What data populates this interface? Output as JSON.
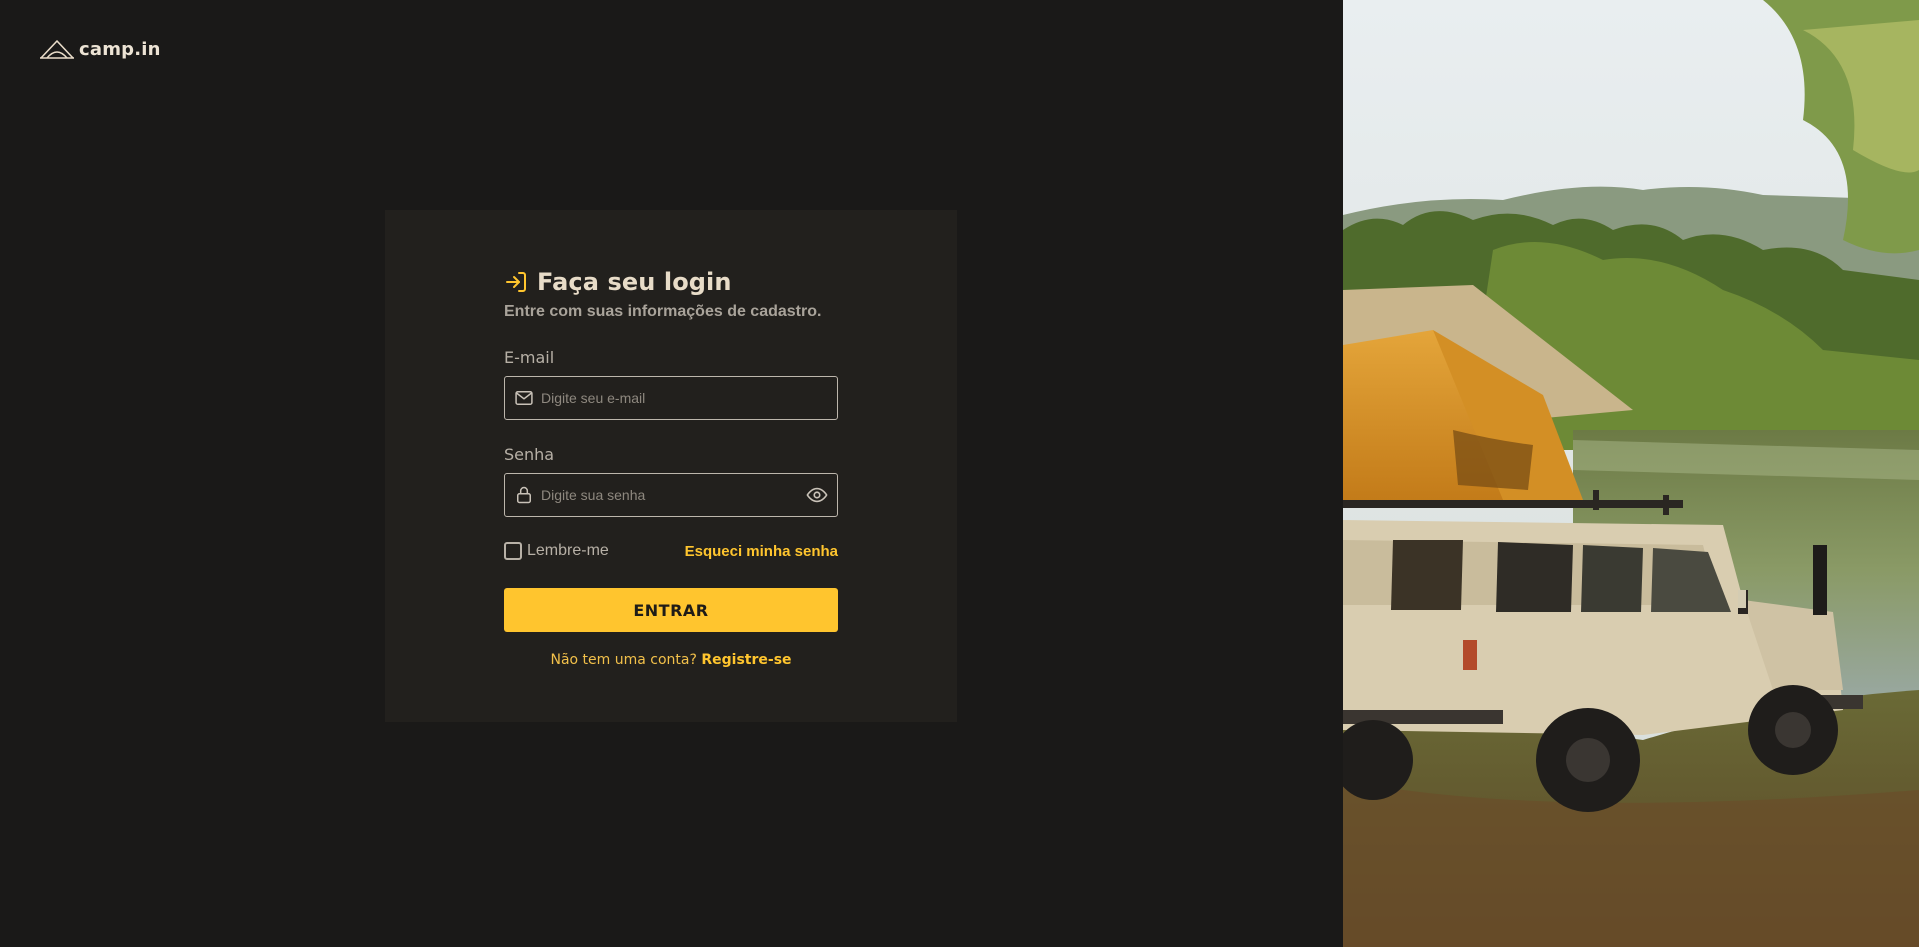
{
  "brand": {
    "name": "camp.in",
    "icon": "tent-logo-icon"
  },
  "login": {
    "title": "Faça seu login",
    "title_icon": "login-arrow-icon",
    "subtitle": "Entre com suas informações de cadastro.",
    "email": {
      "label": "E-mail",
      "placeholder": "Digite seu e-mail",
      "value": "",
      "icon": "mail-icon"
    },
    "password": {
      "label": "Senha",
      "placeholder": "Digite sua senha",
      "value": "",
      "icon": "lock-icon",
      "toggle_icon": "eye-icon"
    },
    "remember_label": "Lembre-me",
    "remember_checked": false,
    "forgot_label": "Esqueci minha senha",
    "submit_label": "ENTRAR",
    "register_prompt": "Não tem uma conta?",
    "register_link": "Registre-se"
  },
  "hero_image": {
    "description": "off-road vehicle with rooftop tent by a lake"
  },
  "colors": {
    "background": "#1a1918",
    "card": "#22201d",
    "accent": "#ffc52e",
    "title": "#e8dcc8",
    "muted": "#a9a39a"
  }
}
